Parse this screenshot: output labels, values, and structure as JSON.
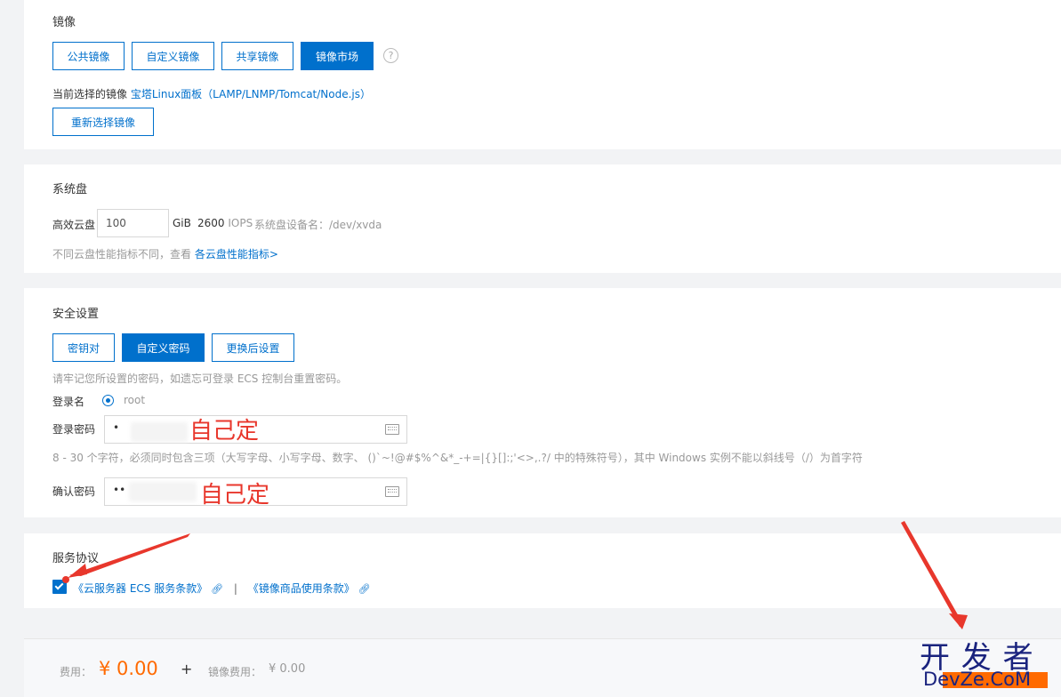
{
  "image": {
    "title": "镜像",
    "tabs": [
      "公共镜像",
      "自定义镜像",
      "共享镜像",
      "镜像市场"
    ],
    "active_tab": 3,
    "current_label": "当前选择的镜像",
    "current_value": "宝塔Linux面板（LAMP/LNMP/Tomcat/Node.js）",
    "reselect": "重新选择镜像"
  },
  "disk": {
    "title": "系统盘",
    "type_label": "高效云盘",
    "size": "100",
    "unit": "GiB",
    "iops_value": "2600",
    "iops_unit": "IOPS",
    "device_label": "系统盘设备名：",
    "device_value": "/dev/xvda",
    "note": "不同云盘性能指标不同，查看",
    "note_link": "各云盘性能指标>"
  },
  "security": {
    "title": "安全设置",
    "tabs": [
      "密钥对",
      "自定义密码",
      "更换后设置"
    ],
    "active_tab": 1,
    "tip": "请牢记您所设置的密码，如遗忘可登录 ECS 控制台重置密码。",
    "login_name_label": "登录名",
    "login_name_value": "root",
    "password_label": "登录密码",
    "password_value": "•",
    "password_hint": "8 - 30 个字符，必须同时包含三项（大写字母、小写字母、数字、 ()`~!@#$%^&*_-+=|{}[]:;'<>,.?/ 中的特殊符号），其中 Windows 实例不能以斜线号（/）为首字符",
    "confirm_label": "确认密码",
    "confirm_value": "••"
  },
  "annotations": {
    "self_set_1": "自己定",
    "self_set_2": "自己定"
  },
  "agreement": {
    "title": "服务协议",
    "link1": "《云服务器 ECS 服务条款》",
    "separator": "|",
    "link2": "《镜像商品使用条款》"
  },
  "footer": {
    "fee_label": "费用：",
    "fee_value": "¥ 0.00",
    "plus": "+",
    "image_fee_label": "镜像费用：",
    "image_fee_value": "¥ 0.00"
  },
  "watermark": {
    "line1": "开 发 者",
    "line2": "DevZe.CoM"
  },
  "colors": {
    "primary": "#0070cc",
    "price": "#ff6a00",
    "annotation": "#e8372c"
  }
}
